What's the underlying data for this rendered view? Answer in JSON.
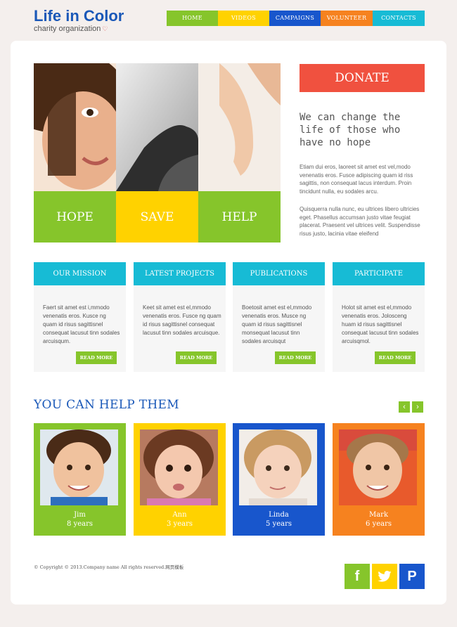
{
  "brand": {
    "title": "Life in Color",
    "subtitle": "charity organization"
  },
  "nav": [
    {
      "label": "HOME",
      "color": "#86c52b"
    },
    {
      "label": "VIDEOS",
      "color": "#ffd200"
    },
    {
      "label": "CAMPAIGNS",
      "color": "#1856cc"
    },
    {
      "label": "VOLUNTEER",
      "color": "#f6821f"
    },
    {
      "label": "CONTACTS",
      "color": "#17bbd5"
    }
  ],
  "hero": {
    "tiles": [
      "HOPE",
      "SAVE",
      "HELP"
    ]
  },
  "donate": {
    "label": "DONATE"
  },
  "intro": {
    "tagline": "We can change the life of those who have no hope",
    "p1": "Etiam dui eros, laoreet sit amet est vel,modo venenatis eros. Fusce adipiscing quam id riss sagittis, non consequat lacus interdum. Proin tincidunt nulla, eu sodales arcu.",
    "p2": "Quisquerra nulla nunc, eu ultrices libero ultricies eget. Phasellus accumsan justo vitae feugiat placerat. Praesent vel ultrices velit. Suspendisse risus justo, lacinia vitae eleifend"
  },
  "boxes": [
    {
      "title": "OUR MISSION",
      "text": "Faert sit amet est i,mmodo venenatis eros. Kusce ng quam id risus sagittisnel consequat lacusut tinn sodales arcuisqum.",
      "more": "READ MORE"
    },
    {
      "title": "LATEST PROJECTS",
      "text": "Keet sit amet est el,mmodo venenatis eros. Fusce ng quam id risus sagittisnel consequat lacusut tinn sodales arcuisque.",
      "more": "READ MORE"
    },
    {
      "title": "PUBLICATIONS",
      "text": "Boetosit amet est el,mmodo venenatis eros. Musce ng quam id risus sagittisnel monsequat lacusut tinn sodales arcuisqut",
      "more": "READ MORE"
    },
    {
      "title": "PARTICIPATE",
      "text": "Holot sit amet est el,mmodo venenatis eros. Jolosceng huam id risus sagittisnel consequat lacusut tinn sodales arcuisqmol.",
      "more": "READ MORE"
    }
  ],
  "help": {
    "title": "YOU CAN HELP THEM"
  },
  "kids": [
    {
      "name": "Jim",
      "age": "8 years",
      "color": "#86c52b"
    },
    {
      "name": "Ann",
      "age": "3 years",
      "color": "#ffd200"
    },
    {
      "name": "Linda",
      "age": "5 years",
      "color": "#1856cc"
    },
    {
      "name": "Mark",
      "age": "6 years",
      "color": "#f6821f"
    }
  ],
  "footer": {
    "copyright": "© Copyright © 2013.Company name All rights reserved.网页模板"
  },
  "social": [
    {
      "icon": "facebook-icon",
      "glyph": "f",
      "color": "#86c52b"
    },
    {
      "icon": "twitter-icon",
      "glyph": "🐦",
      "color": "#ffd200"
    },
    {
      "icon": "pinterest-icon",
      "glyph": "P",
      "color": "#1856cc"
    }
  ]
}
